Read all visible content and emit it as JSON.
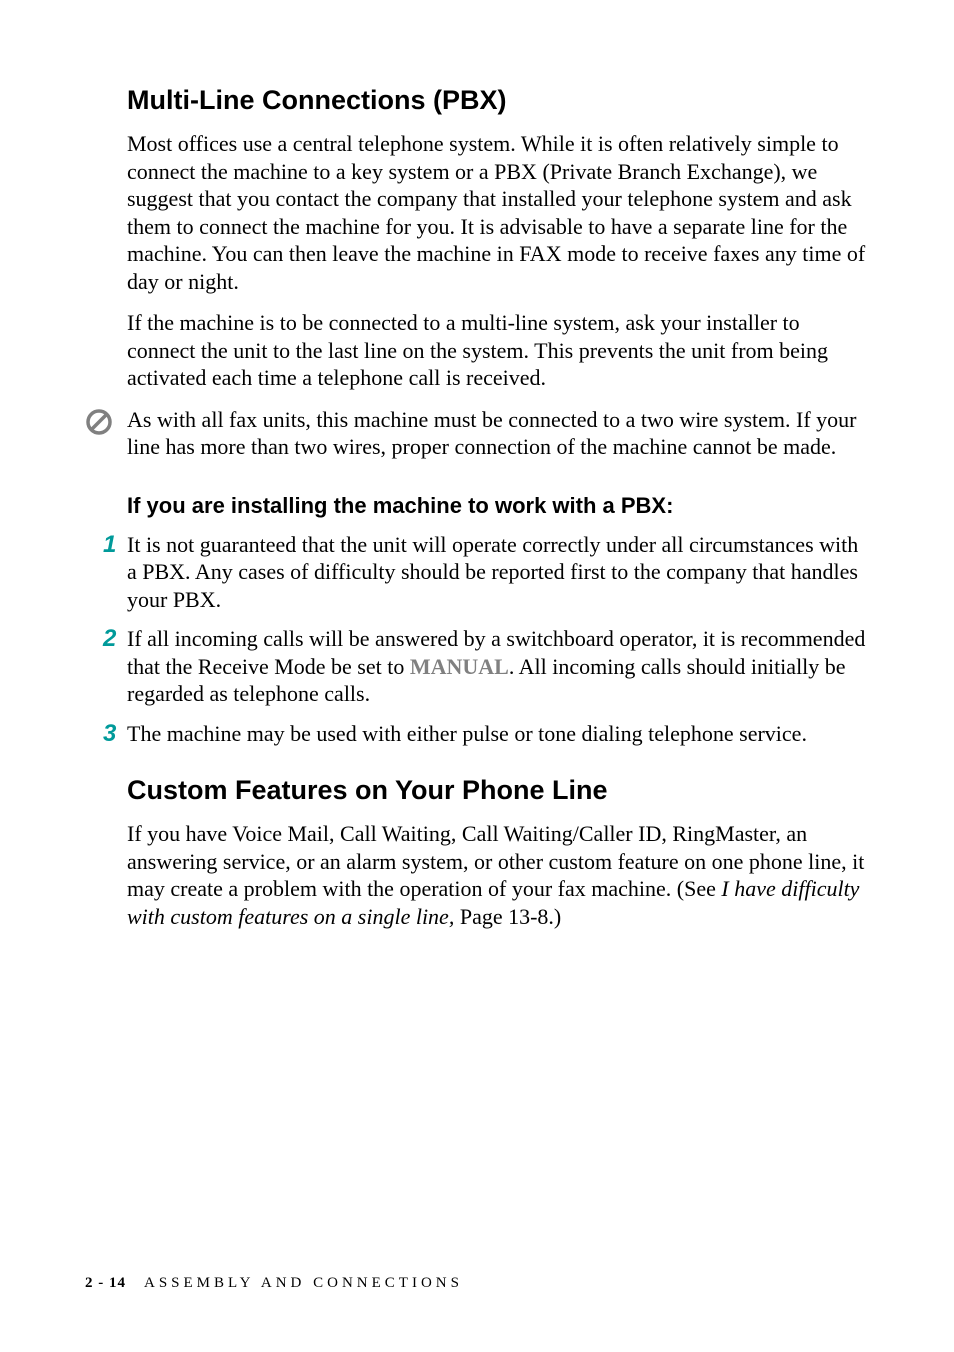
{
  "heading1": "Multi-Line Connections (PBX)",
  "para1": "Most offices use a central telephone system. While it is often relatively simple to connect the machine to a key system or a PBX (Private Branch Exchange), we suggest that you contact the company that installed your telephone system and ask them to connect the machine for you. It is advisable to have a separate line for the machine. You can then leave the machine in FAX mode to receive faxes any time of day or night.",
  "para2": "If the machine is to be connected to a multi-line system, ask your installer to connect the unit to the last line on the system. This prevents the unit from being activated each time a telephone call is received.",
  "note": "As with all fax units, this machine must be connected to a two wire system. If your line has more than two wires, proper connection of the machine cannot be made.",
  "heading3": "If you are installing the machine to work with a PBX:",
  "items": [
    {
      "num": "1",
      "text": "It is not guaranteed that the unit will operate correctly under all circumstances with a PBX. Any cases of difficulty should be reported first to the company that handles your PBX."
    },
    {
      "num": "2",
      "text_before": "If all incoming calls will be answered by a switchboard operator, it is recommended that the Receive Mode be set to ",
      "bold": "MANUAL",
      "text_after": ". All incoming calls should initially be regarded as telephone calls."
    },
    {
      "num": "3",
      "text": "The machine may be used with either pulse or tone dialing telephone service."
    }
  ],
  "heading2": "Custom Features on Your Phone Line",
  "last_para_before": "If you have Voice Mail, Call Waiting, Call Waiting/Caller ID, RingMaster, an answering service, or an alarm system, or other custom feature on one phone line, it may create a problem with the operation of your fax machine. (See ",
  "last_para_italic": "I have difficulty with custom features on a single line,",
  "last_para_after": " Page 13-8.)",
  "footer": {
    "page": "2 - 14",
    "chapter": "ASSEMBLY AND CONNECTIONS"
  }
}
